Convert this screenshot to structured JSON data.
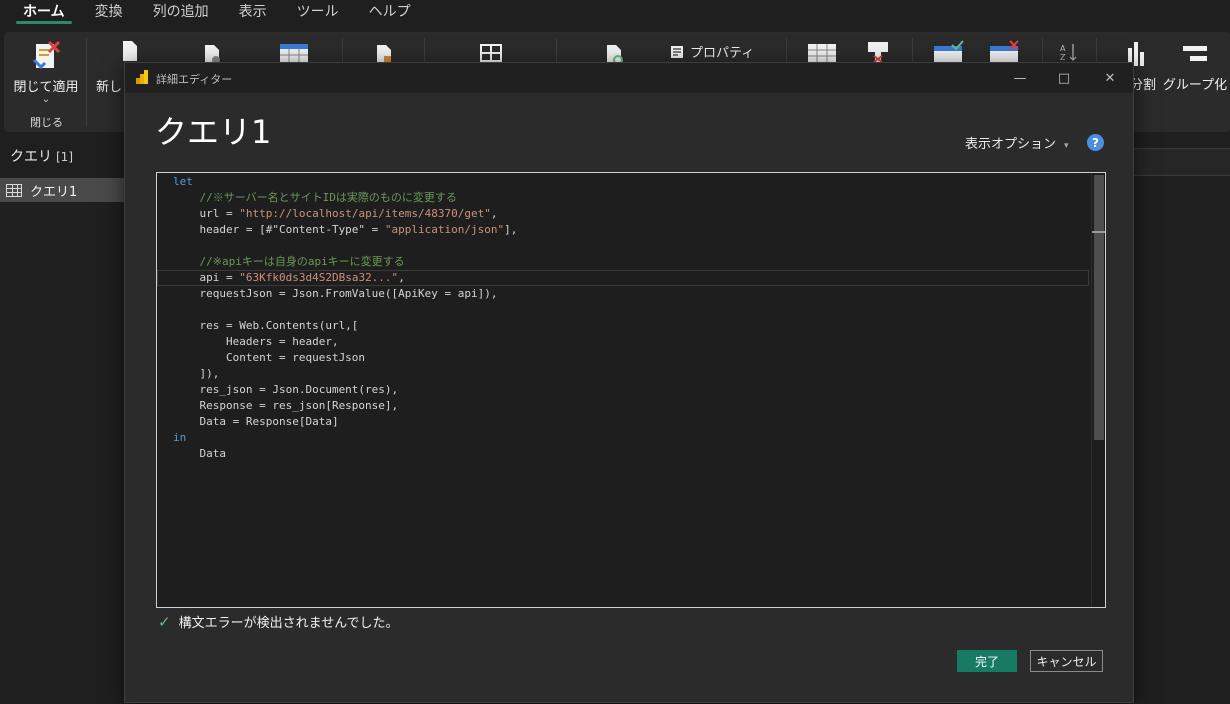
{
  "menu": {
    "tabs": [
      "ホーム",
      "変換",
      "列の追加",
      "表示",
      "ツール",
      "ヘルプ"
    ]
  },
  "ribbon": {
    "close_apply_label": "閉じて適用",
    "close_apply_caret": "⌄",
    "close_group_label": "閉じる",
    "new_label": "新し",
    "properties_label": "プロパティ",
    "split_label": "分割",
    "groupby_label": "グループ化"
  },
  "query_pane": {
    "title": "クエリ",
    "count": "[1]",
    "items": [
      "クエリ1"
    ]
  },
  "dialog": {
    "window_title": "詳細エディター",
    "query_title": "クエリ1",
    "display_options_label": "表示オプション",
    "display_options_caret": "▾",
    "help_glyph": "?",
    "minimize_glyph": "—",
    "maximize_glyph": "□",
    "close_glyph": "✕",
    "status_check": "✓",
    "status_text": "構文エラーが検出されませんでした。",
    "done_label": "完了",
    "cancel_label": "キャンセル",
    "code": {
      "l1": "let",
      "l2": "    //※サーバー名とサイトIDは実際のものに変更する",
      "l3a": "    url = ",
      "l3b": "\"http://localhost/api/items/48370/get\"",
      "l3c": ",",
      "l4a": "    header = [#\"Content-Type\" = ",
      "l4b": "\"application/json\"",
      "l4c": "],",
      "l5": "",
      "l6": "    //※apiキーは自身のapiキーに変更する",
      "l7a": "    api = ",
      "l7b": "\"63Kfk0ds3d4S2DBsa32...\"",
      "l7c": ",",
      "l8": "    requestJson = Json.FromValue([ApiKey = api]),",
      "l9": "",
      "l10": "    res = Web.Contents(url,[",
      "l11": "        Headers = header,",
      "l12": "        Content = requestJson",
      "l13": "    ]),",
      "l14": "    res_json = Json.Document(res),",
      "l15": "    Response = res_json[Response],",
      "l16": "    Data = Response[Data]",
      "l17": "in",
      "l18": "    Data"
    }
  },
  "colors": {
    "accent": "#177a62",
    "keyword": "#569cd6",
    "comment": "#6a9955",
    "string": "#ce9178"
  }
}
